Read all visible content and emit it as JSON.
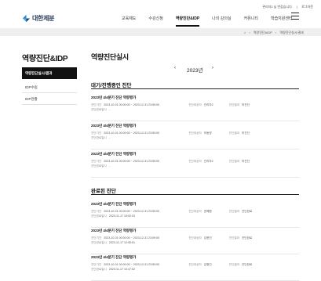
{
  "header": {
    "util_links": [
      "관리자2 님 반갑습니다.",
      "로그아웃"
    ],
    "logo_text": "대한제분",
    "gnb": [
      "교육제도",
      "수강신청",
      "역량진단&IDP",
      "나의 강의실",
      "커뮤니티",
      "학습지원센터"
    ],
    "gnb_active": "역량진단&IDP"
  },
  "breadcrumb": {
    "home": "⌂",
    "items": [
      "역량진단&IDP",
      "역량진단실시/결과"
    ]
  },
  "lnb": {
    "title": "역량진단&IDP",
    "items": [
      {
        "label": "역량진단실시/결과",
        "active": true
      },
      {
        "label": "IDP수립",
        "active": false
      },
      {
        "label": "IDP현황",
        "active": false
      }
    ]
  },
  "content": {
    "title": "역량진단실시",
    "year": {
      "prev": "‹",
      "value": "2023년",
      "next": "›"
    },
    "labels": {
      "period": "진단기간",
      "target": "진단대상자",
      "result": "진단결과",
      "completed_at": "진단완료일시"
    },
    "pending": {
      "title": "대기/진행중인 진단",
      "items": [
        {
          "name": "2023년 4/4분기 진단 역량평가",
          "period": "2023-10-01 00:00:00 ~ 2023-12-31 23:59:00",
          "target": "관리자2",
          "result": "미진단",
          "completed": "-"
        },
        {
          "name": "2023년 4/4분기 진단 역량평가",
          "period": "2023-10-01 00:00:00 ~ 2023-12-31 23:59:00",
          "target": "허동영",
          "result": "미진단",
          "completed": "-"
        },
        {
          "name": "2023년 4/4분기 진단 역량평가",
          "period": "2023-10-01 00:00:00 ~ 2023-12-31 23:59:00",
          "target": "관리자2",
          "result": "미진단",
          "completed": "-"
        }
      ]
    },
    "done": {
      "title": "완료된 진단",
      "items": [
        {
          "name": "2023년 4/4분기 진단 역량평가",
          "period": "2023-10-01 00:00:00 ~ 2023-12-31 23:59:00",
          "target": "권혜원",
          "result": "진단완료",
          "completed": "2023-11-17 15:52:03"
        },
        {
          "name": "2023년 4/4분기 진단 역량평가",
          "period": "2023-10-01 00:00:00 ~ 2023-12-31 23:59:00",
          "target": "김현진",
          "result": "진단완료",
          "completed": "2023-11-17 12:55:51"
        },
        {
          "name": "2023년 4/4분기 진단 역량평가",
          "period": "2023-10-01 00:00:00 ~ 2023-12-31 23:59:00",
          "target": "김형진",
          "result": "진단완료",
          "completed": "2023-11-17 10:47:52"
        }
      ]
    }
  }
}
